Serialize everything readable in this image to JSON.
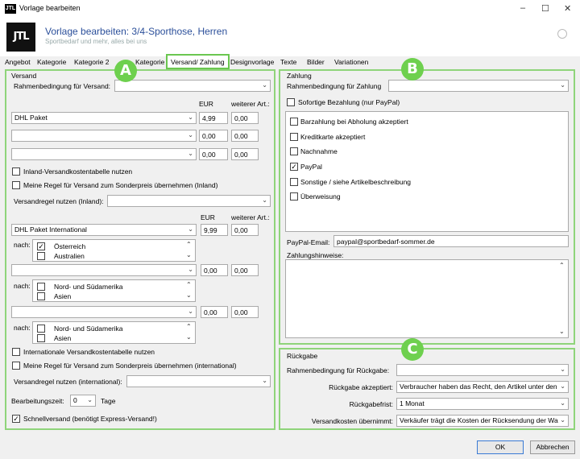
{
  "window": {
    "title": "Vorlage bearbeiten",
    "min": "–",
    "max": "☐",
    "close": "✕"
  },
  "header": {
    "logo": "JTL",
    "title": "Vorlage bearbeiten: 3/4-Sporthose, Herren",
    "subtitle": "Sportbedarf und mehr, alles bei uns"
  },
  "tabs": [
    "Angebot",
    "Kategorie",
    "Kategorie 2",
    "Kategorie",
    "Versand/ Zahlung",
    "Designvorlage",
    "Texte",
    "Bilder",
    "Variationen"
  ],
  "versand": {
    "title": "Versand",
    "rahmen_label": "Rahmenbedingung für Versand:",
    "eur": "EUR",
    "weitere": "weiterer Art.:",
    "rows": [
      {
        "method": "DHL Paket",
        "eur": "4,99",
        "weitere": "0,00"
      },
      {
        "method": "",
        "eur": "0,00",
        "weitere": "0,00"
      },
      {
        "method": "",
        "eur": "0,00",
        "weitere": "0,00"
      }
    ],
    "inland_table": "Inland-Versandkostentabelle nutzen",
    "meine_regel_inland": "Meine Regel für Versand zum Sonderpreis übernehmen (Inland)",
    "regel_inland_label": "Versandregel nutzen (Inland):",
    "intl_eur": "EUR",
    "intl_weitere": "weiterer Art.:",
    "intl_rows": [
      {
        "method": "DHL Paket International",
        "eur": "9,99",
        "weitere": "0,00",
        "nach": "nach:",
        "countries": [
          {
            "name": "Österreich",
            "checked": true
          },
          {
            "name": "Australien",
            "checked": false
          }
        ]
      },
      {
        "method": "",
        "eur": "0,00",
        "weitere": "0,00",
        "nach": "nach:",
        "countries": [
          {
            "name": "Nord- und Südamerika",
            "checked": false
          },
          {
            "name": "Asien",
            "checked": false
          }
        ]
      },
      {
        "method": "",
        "eur": "0,00",
        "weitere": "0,00",
        "nach": "nach:",
        "countries": [
          {
            "name": "Nord- und Südamerika",
            "checked": false
          },
          {
            "name": "Asien",
            "checked": false
          }
        ]
      }
    ],
    "intl_table": "Internationale Versandkostentabelle nutzen",
    "meine_regel_intl": "Meine Regel für Versand zum Sonderpreis übernehmen (international)",
    "regel_intl_label": "Versandregel nutzen (international):",
    "bearbeitungszeit_label": "Bearbeitungszeit:",
    "bearbeitungszeit_value": "0",
    "tage": "Tage",
    "schnellversand": "Schnellversand (benötigt Express-Versand!)"
  },
  "zahlung": {
    "title": "Zahlung",
    "rahmen_label": "Rahmenbedingung für Zahlung",
    "sofort": "Sofortige Bezahlung (nur PayPal)",
    "methods": [
      {
        "name": "Barzahlung bei Abholung akzeptiert",
        "checked": false
      },
      {
        "name": "Kreditkarte akzeptiert",
        "checked": false
      },
      {
        "name": "Nachnahme",
        "checked": false
      },
      {
        "name": "PayPal",
        "checked": true
      },
      {
        "name": "Sonstige / siehe Artikelbeschreibung",
        "checked": false
      },
      {
        "name": "Überweisung",
        "checked": false
      }
    ],
    "paypal_label": "PayPal-Email:",
    "paypal_value": "paypal@sportbedarf-sommer.de",
    "hinweise_label": "Zahlungshinweise:"
  },
  "rueckgabe": {
    "title": "Rückgabe",
    "rahmen_label": "Rahmenbedingung für Rückgabe:",
    "akzeptiert_label": "Rückgabe akzeptiert:",
    "akzeptiert_value": "Verbraucher haben das Recht, den Artikel unter den",
    "frist_label": "Rückgabefrist:",
    "frist_value": "1 Monat",
    "kosten_label": "Versandkosten übernimmt:",
    "kosten_value": "Verkäufer trägt die Kosten der Rücksendung der Wa"
  },
  "badges": {
    "a": "A",
    "b": "B",
    "c": "C"
  },
  "footer": {
    "ok": "OK",
    "cancel": "Abbrechen"
  },
  "colors": {
    "accent_green": "#6ed04e",
    "title_blue": "#2b4f9a"
  }
}
